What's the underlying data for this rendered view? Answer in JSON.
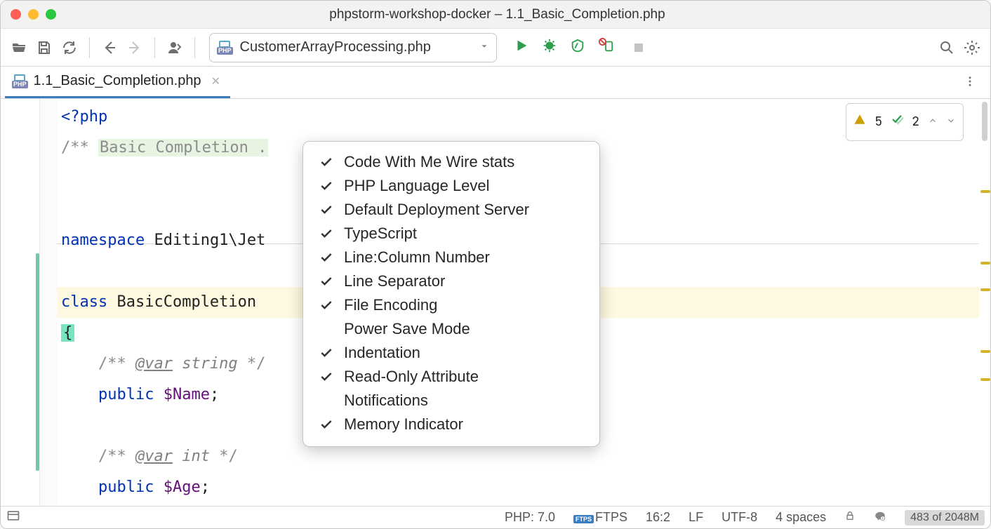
{
  "window": {
    "title": "phpstorm-workshop-docker – 1.1_Basic_Completion.php"
  },
  "toolbar": {
    "configuration": "CustomerArrayProcessing.php"
  },
  "tab": {
    "label": "1.1_Basic_Completion.php",
    "filetype": "PHP"
  },
  "inspections": {
    "warnings": "5",
    "checks": "2"
  },
  "code": {
    "open_tag": "<?php",
    "comment_prefix": "/** ",
    "comment_highlight": "Basic Completion .",
    "namespace_kw": "namespace",
    "namespace_val": "Editing1\\Jet",
    "class_kw": "class",
    "class_name": "BasicCompletion",
    "brace": "{",
    "var_ann": "@var",
    "type_string": "string",
    "type_int": "int",
    "comment_open": "/** ",
    "comment_close_partial": " */",
    "comment_close": " */",
    "public_kw": "public",
    "var_name1": "$Name",
    "var_name2": "$Age",
    "semi": ";"
  },
  "popup": {
    "items": [
      {
        "checked": true,
        "label": "Code With Me Wire stats"
      },
      {
        "checked": true,
        "label": "PHP Language Level"
      },
      {
        "checked": true,
        "label": "Default Deployment Server"
      },
      {
        "checked": true,
        "label": "TypeScript"
      },
      {
        "checked": true,
        "label": "Line:Column Number"
      },
      {
        "checked": true,
        "label": "Line Separator"
      },
      {
        "checked": true,
        "label": "File Encoding"
      },
      {
        "checked": false,
        "label": "Power Save Mode"
      },
      {
        "checked": true,
        "label": "Indentation"
      },
      {
        "checked": true,
        "label": "Read-Only Attribute"
      },
      {
        "checked": false,
        "label": "Notifications"
      },
      {
        "checked": true,
        "label": "Memory Indicator"
      }
    ]
  },
  "status": {
    "php": "PHP: 7.0",
    "deploy": "FTPS",
    "pos": "16:2",
    "sep": "LF",
    "enc": "UTF-8",
    "indent": "4 spaces",
    "memory": "483 of 2048M"
  }
}
